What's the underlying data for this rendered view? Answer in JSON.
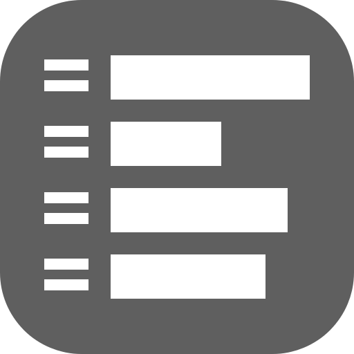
{
  "app_icon": {
    "name": "bar-list-icon",
    "colors": {
      "background": "#5f5f5f",
      "foreground": "#ffffff"
    },
    "rows": [
      {
        "level": 1.0
      },
      {
        "level": 0.556
      },
      {
        "level": 0.889
      },
      {
        "level": 0.778
      }
    ]
  }
}
